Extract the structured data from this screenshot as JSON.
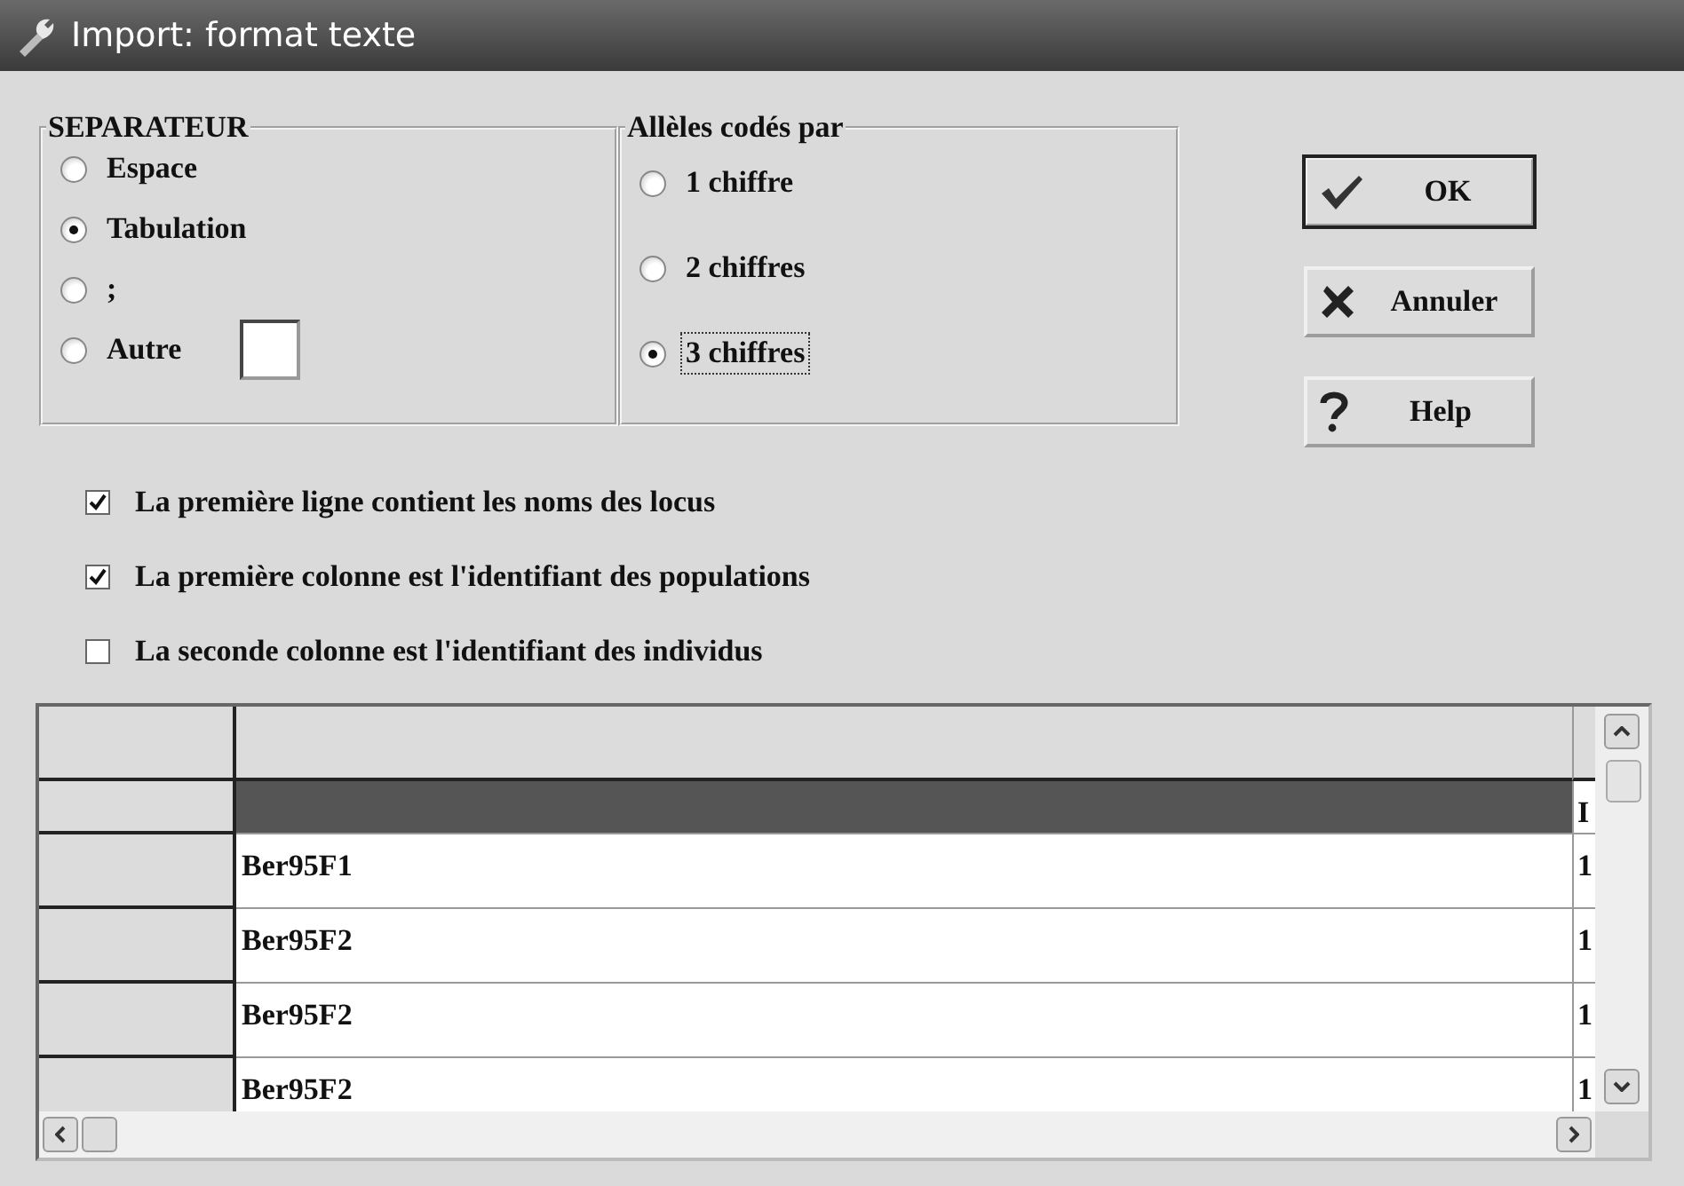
{
  "window": {
    "title": "Import: format texte"
  },
  "separator": {
    "title": "SEPARATEUR",
    "options": [
      {
        "label": "Espace",
        "selected": false,
        "kind": "radio"
      },
      {
        "label": "Tabulation",
        "selected": true,
        "kind": "radio"
      },
      {
        "label": ";",
        "selected": false,
        "kind": "radio"
      },
      {
        "label": "Autre",
        "selected": false,
        "kind": "radio-field"
      }
    ]
  },
  "alleles": {
    "title": "Allèles codés par",
    "options": [
      {
        "label": "1 chiffre",
        "selected": false,
        "focused": false
      },
      {
        "label": "2 chiffres",
        "selected": false,
        "focused": false
      },
      {
        "label": "3 chiffres",
        "selected": true,
        "focused": true
      }
    ]
  },
  "buttons": [
    {
      "label": "OK",
      "kind": "ok",
      "default": true
    },
    {
      "label": "Annuler",
      "kind": "cancel",
      "default": false
    },
    {
      "label": "Help",
      "kind": "help",
      "default": false
    }
  ],
  "options": [
    {
      "label": "La première ligne contient les noms des locus",
      "checked": true
    },
    {
      "label": "La première colonne est l'identifiant des populations",
      "checked": true
    },
    {
      "label": "La seconde colonne est l'identifiant des individus",
      "checked": false
    }
  ],
  "grid": {
    "rows": [
      {
        "selected": true,
        "column_3": "I"
      },
      {
        "selected": false,
        "column_2": "Ber95F1",
        "column_3": "1"
      },
      {
        "selected": false,
        "column_2": "Ber95F2",
        "column_3": "1"
      },
      {
        "selected": false,
        "column_2": "Ber95F2",
        "column_3": "1"
      },
      {
        "selected": false,
        "column_2": "Ber95F2",
        "column_3": "1"
      }
    ]
  }
}
